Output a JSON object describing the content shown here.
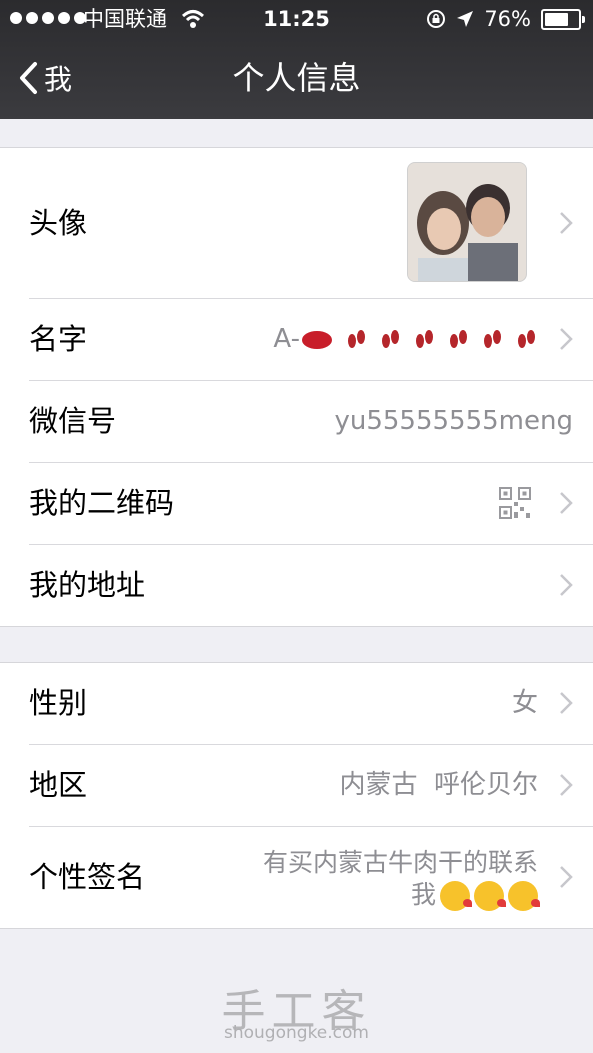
{
  "status_bar": {
    "carrier": "中国联通",
    "time": "11:25",
    "battery": "76%",
    "battery_level": 0.76
  },
  "nav": {
    "back_label": "我",
    "title": "个人信息"
  },
  "group1": {
    "avatar_label": "头像",
    "name_label": "名字",
    "name_value_prefix": "A-",
    "wechat_id_label": "微信号",
    "wechat_id_value": "yu55555555meng",
    "qr_label": "我的二维码",
    "address_label": "我的地址"
  },
  "group2": {
    "gender_label": "性别",
    "gender_value": "女",
    "region_label": "地区",
    "region_value": "内蒙古  呼伦贝尔",
    "signature_label": "个性签名",
    "signature_line1": "有买内蒙古牛肉干的联系",
    "signature_line2": "我"
  },
  "watermark": {
    "text": "手工客",
    "url": "shougongke.com"
  },
  "icons": {
    "back": "chevron-left-icon",
    "row_arrow": "chevron-right-icon",
    "qr": "qr-code-icon"
  },
  "colors": {
    "nav_bg": "#333336",
    "page_bg": "#efeff4",
    "secondary_text": "#8e8e93"
  }
}
